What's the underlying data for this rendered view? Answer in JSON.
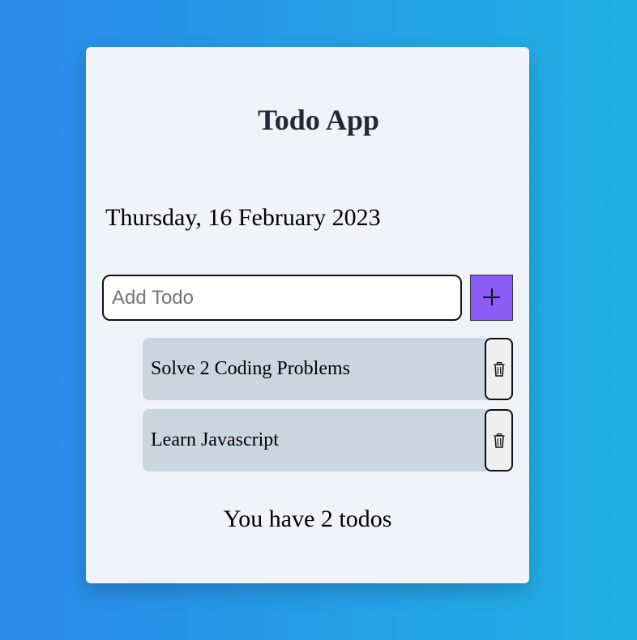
{
  "app": {
    "title": "Todo App",
    "date": "Thursday, 16 February 2023"
  },
  "add_todo": {
    "placeholder": "Add Todo",
    "value": "",
    "button_icon": "plus-icon"
  },
  "todos": [
    {
      "text": "Solve 2 Coding Problems",
      "delete_icon": "trash-icon"
    },
    {
      "text": "Learn Javascript",
      "delete_icon": "trash-icon"
    }
  ],
  "summary": {
    "count_text": "You have 2 todos"
  },
  "colors": {
    "background_start": "#2b89e9",
    "background_end": "#20b0e2",
    "card": "#f0f4f8",
    "accent": "#8b5cf6",
    "todo_item": "#cbd5e0"
  }
}
